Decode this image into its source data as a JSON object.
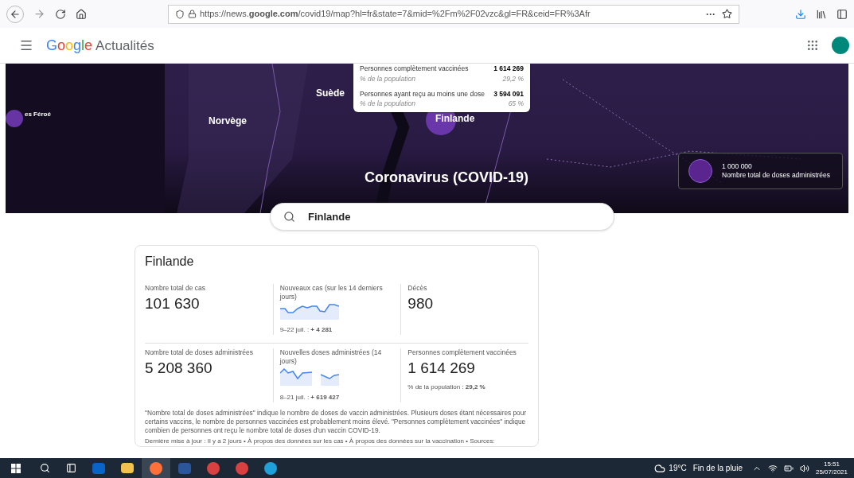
{
  "browser": {
    "url": "https://news.**google.com**/covid19/map?hl=fr&state=7&mid=%2Fm%2F02vzc&gl=FR&ceid=FR%3Afr",
    "menu_dots": "···"
  },
  "header": {
    "logo": "Google",
    "title": "Actualités"
  },
  "map": {
    "labels": [
      {
        "text": "es Féroé",
        "kind": "small"
      },
      {
        "text": "Norvège",
        "kind": "country"
      },
      {
        "text": "Suède",
        "kind": "country"
      },
      {
        "text": "Finlande",
        "kind": "country"
      }
    ],
    "tooltip": [
      {
        "label": "Personnes complètement vaccinées",
        "value": "1 614 269",
        "sub_label": "% de la population",
        "sub_value": "29,2 %"
      },
      {
        "label": "Personnes ayant reçu au moins une dose",
        "value": "3 594 091",
        "sub_label": "% de la population",
        "sub_value": "65 %"
      }
    ],
    "title": "Coronavirus (COVID-19)",
    "legend": {
      "value": "1 000 000",
      "label": "Nombre total de doses administrées"
    }
  },
  "search": {
    "value": "Finlande"
  },
  "card": {
    "title": "Finlande",
    "rows": [
      [
        {
          "label": "Nombre total de cas",
          "value": "101 630"
        },
        {
          "label": "Nouveaux cas (sur les 14 derniers jours)",
          "kind": "chart",
          "note": "9–22 juil. : **+ 4 281**"
        },
        {
          "label": "Décès",
          "value": "980"
        }
      ],
      [
        {
          "label": "Nombre total de doses administrées",
          "value": "5 208 360"
        },
        {
          "label": "Nouvelles doses administrées (14 jours)",
          "kind": "chart",
          "note": "8–21 juil. : **+ 619 427**"
        },
        {
          "label": "Personnes complètement vaccinées",
          "value": "1 614 269",
          "note": "% de la population : **29,2 %**"
        }
      ]
    ],
    "footnote": "\"Nombre total de doses administrées\" indique le nombre de doses de vaccin administrées. Plusieurs doses étant nécessaires pour certains vaccins, le nombre de personnes vaccinées est probablement moins élevé. \"Personnes complètement vaccinées\" indique combien de personnes ont reçu le nombre total de doses d'un vaccin COVID-19.",
    "updated": "Dernière mise à jour : Il y a 2 jours • À propos des données sur les cas • À propos des données sur la vaccination • Sources:"
  },
  "taskbar": {
    "weather": "19°C",
    "forecast": "Fin de la pluie",
    "time": "15:51",
    "date": "25/07/2021"
  }
}
